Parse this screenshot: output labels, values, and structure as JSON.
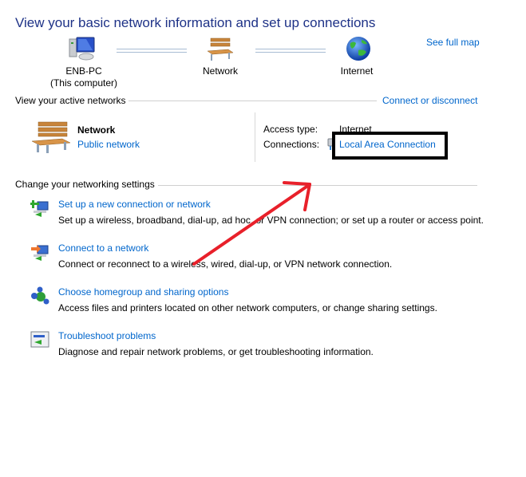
{
  "header": {
    "title": "View your basic network information and set up connections",
    "see_full_map": "See full map"
  },
  "network_map": {
    "nodes": [
      {
        "label": "ENB-PC",
        "sublabel": "(This computer)",
        "icon": "computer-icon"
      },
      {
        "label": "Network",
        "icon": "bench-icon"
      },
      {
        "label": "Internet",
        "icon": "globe-icon"
      }
    ]
  },
  "active_networks": {
    "section_label": "View your active networks",
    "connect_or_disconnect": "Connect or disconnect",
    "network_name": "Network",
    "network_type": "Public network",
    "access_type_label": "Access type:",
    "access_type_value": "Internet",
    "connections_label": "Connections:",
    "connections_value": "Local Area Connection"
  },
  "settings": {
    "section_label": "Change your networking settings",
    "items": [
      {
        "title": "Set up a new connection or network",
        "description": "Set up a wireless, broadband, dial-up, ad hoc, or VPN connection; or set up a router or access point.",
        "icon": "new-connection-icon"
      },
      {
        "title": "Connect to a network",
        "description": "Connect or reconnect to a wireless, wired, dial-up, or VPN network connection.",
        "icon": "connect-network-icon"
      },
      {
        "title": "Choose homegroup and sharing options",
        "description": "Access files and printers located on other network computers, or change sharing settings.",
        "icon": "homegroup-icon"
      },
      {
        "title": "Troubleshoot problems",
        "description": "Diagnose and repair network problems, or get troubleshooting information.",
        "icon": "troubleshoot-icon"
      }
    ]
  },
  "annotations": {
    "highlight_color": "#000000",
    "arrow_color": "#e8202a"
  }
}
